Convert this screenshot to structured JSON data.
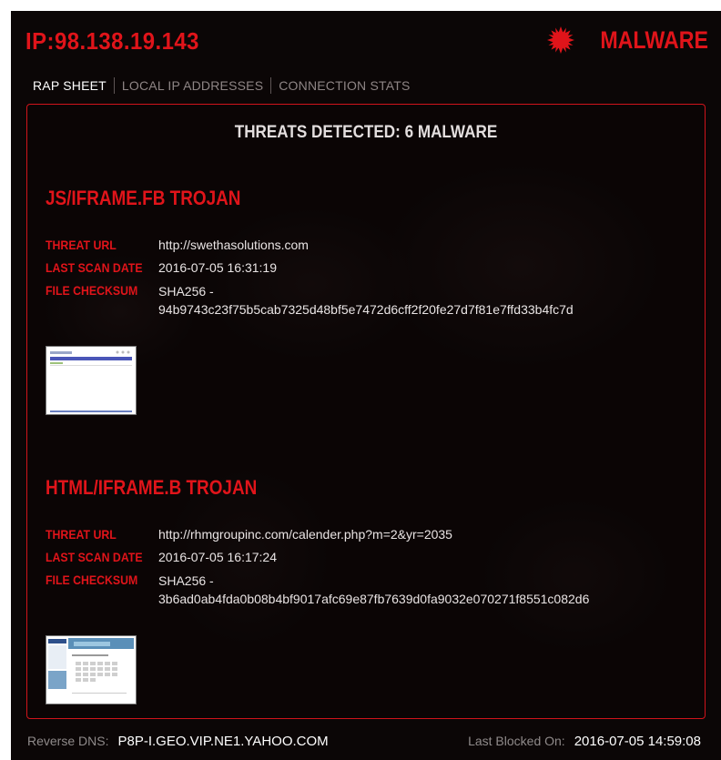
{
  "header": {
    "ip_title": "IP:98.138.19.143",
    "brand_label": "MALWARE",
    "brand_icon": "virus-icon",
    "accent_color": "#e0141a"
  },
  "tabs": [
    {
      "label": "RAP SHEET",
      "active": true
    },
    {
      "label": "LOCAL IP ADDRESSES",
      "active": false
    },
    {
      "label": "CONNECTION STATS",
      "active": false
    }
  ],
  "panel": {
    "title": "THREATS DETECTED: 6 MALWARE"
  },
  "threats": [
    {
      "name": "JS/IFRAME.FB TROJAN",
      "url_label": "THREAT URL",
      "url": "http://swethasolutions.com",
      "scan_label": "LAST SCAN DATE",
      "scan_date": "2016-07-05 16:31:19",
      "checksum_label": "FILE CHECKSUM",
      "checksum_algo": "SHA256 -",
      "checksum": "94b9743c23f75b5cab7325d48bf5e7472d6cff2f20fe27d7f81e7ffd33b4fc7d"
    },
    {
      "name": "HTML/IFRAME.B TROJAN",
      "url_label": "THREAT URL",
      "url": "http://rhmgroupinc.com/calender.php?m=2&yr=2035",
      "scan_label": "LAST SCAN DATE",
      "scan_date": "2016-07-05 16:17:24",
      "checksum_label": "FILE CHECKSUM",
      "checksum_algo": "SHA256 -",
      "checksum": "3b6ad0ab4fda0b08b4bf9017afc69e87fb7639d0fa9032e070271f8551c082d6"
    }
  ],
  "footer": {
    "dns_label": "Reverse DNS:",
    "dns_value": "P8P-I.GEO.VIP.NE1.YAHOO.COM",
    "blocked_label": "Last Blocked On:",
    "blocked_value": "2016-07-05 14:59:08"
  }
}
